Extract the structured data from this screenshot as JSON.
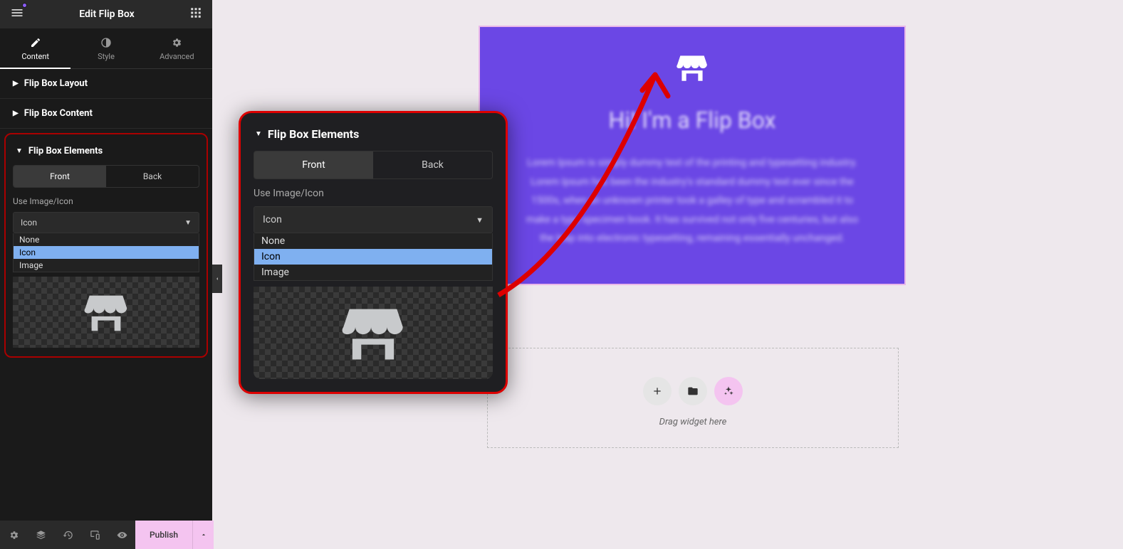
{
  "header": {
    "title": "Edit Flip Box"
  },
  "tabs": {
    "content": "Content",
    "style": "Style",
    "advanced": "Advanced"
  },
  "sections": {
    "layout": "Flip Box Layout",
    "content": "Flip Box Content",
    "elements": "Flip Box Elements"
  },
  "elements_panel": {
    "front": "Front",
    "back": "Back",
    "use_label": "Use Image/Icon",
    "selected": "Icon",
    "options": {
      "none": "None",
      "icon": "Icon",
      "image": "Image"
    }
  },
  "preview": {
    "heading": "Hi! I'm a Flip Box",
    "body": "Lorem Ipsum is simply dummy text of the printing and typesetting industry. Lorem Ipsum has been the industry's standard dummy text ever since the 1500s, when an unknown printer took a galley of type and scrambled it to make a type specimen book. It has survived not only five centuries, but also the leap into electronic typesetting, remaining essentially unchanged."
  },
  "dropzone": {
    "hint": "Drag widget here"
  },
  "footer": {
    "publish": "Publish"
  }
}
